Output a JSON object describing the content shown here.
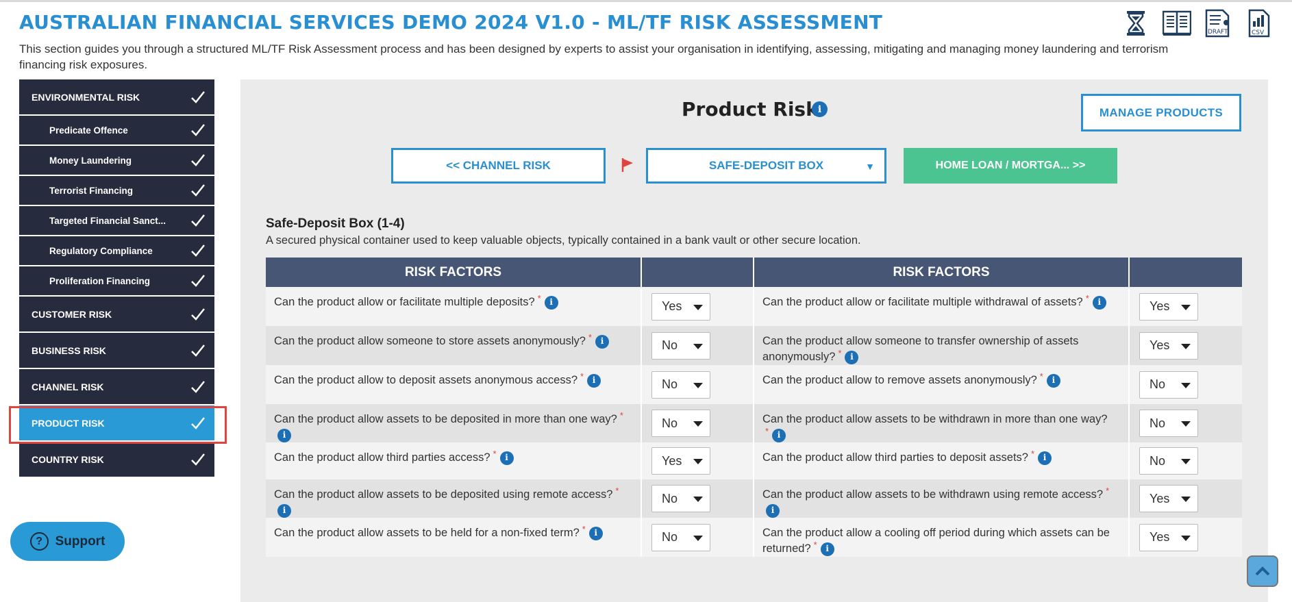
{
  "app": {
    "title": "AUSTRALIAN FINANCIAL SERVICES DEMO 2024 V1.0 - ML/TF RISK ASSESSMENT",
    "description": "This section guides you through a structured ML/TF Risk Assessment process and has been designed by experts to assist your organisation in identifying, assessing, mitigating and managing money laundering and terrorism financing risk exposures."
  },
  "top_icons": [
    "hourglass-icon",
    "book-icon",
    "draft-icon",
    "csv-icon"
  ],
  "top_icon_labels": {
    "draft": "DRAFT",
    "csv": "CSV"
  },
  "sidebar": {
    "items": [
      {
        "label": "ENVIRONMENTAL RISK",
        "type": "main",
        "completed": true
      },
      {
        "label": "Predicate Offence",
        "type": "sub",
        "completed": true
      },
      {
        "label": "Money Laundering",
        "type": "sub",
        "completed": true
      },
      {
        "label": "Terrorist Financing",
        "type": "sub",
        "completed": true
      },
      {
        "label": "Targeted Financial Sanct...",
        "type": "sub",
        "completed": true
      },
      {
        "label": "Regulatory Compliance",
        "type": "sub",
        "completed": true
      },
      {
        "label": "Proliferation Financing",
        "type": "sub",
        "completed": true
      },
      {
        "label": "CUSTOMER RISK",
        "type": "main",
        "completed": true
      },
      {
        "label": "BUSINESS RISK",
        "type": "main",
        "completed": true
      },
      {
        "label": "CHANNEL RISK",
        "type": "main",
        "completed": true
      },
      {
        "label": "PRODUCT RISK",
        "type": "main",
        "completed": true,
        "active": true
      },
      {
        "label": "COUNTRY RISK",
        "type": "main",
        "completed": true
      }
    ]
  },
  "support": {
    "label": "Support",
    "icon_glyph": "?"
  },
  "main": {
    "title": "Product Risk",
    "manage_products_label": "MANAGE PRODUCTS",
    "prev_label": "<< CHANNEL RISK",
    "current_product": "SAFE-DEPOSIT BOX",
    "next_label": "HOME LOAN / MORTGA... >>",
    "section_title": "Safe-Deposit Box (1-4)",
    "section_description": "A secured physical container used to keep valuable objects, typically contained in a bank vault or other secure location.",
    "table_headers": [
      "RISK FACTORS",
      "",
      "RISK FACTORS",
      ""
    ],
    "info_glyph": "i",
    "required_mark": "*",
    "rows": [
      {
        "left_q": "Can the product allow or facilitate multiple deposits?",
        "left_a": "Yes",
        "right_q": "Can the product allow or facilitate multiple withdrawal of assets?",
        "right_a": "Yes"
      },
      {
        "left_q": "Can the product allow someone to store assets anonymously?",
        "left_a": "No",
        "right_q": "Can the product allow someone to transfer ownership of assets anonymously?",
        "right_a": "Yes"
      },
      {
        "left_q": "Can the product allow to deposit assets anonymous access?",
        "left_a": "No",
        "right_q": "Can the product allow to remove assets anonymously?",
        "right_a": "No"
      },
      {
        "left_q": "Can the product allow assets to be deposited in more than one way?",
        "left_a": "No",
        "right_q": "Can the product allow assets to be withdrawn in more than one way?",
        "right_a": "No"
      },
      {
        "left_q": "Can the product allow third parties access?",
        "left_a": "Yes",
        "right_q": "Can the product allow third parties to deposit assets?",
        "right_a": "No"
      },
      {
        "left_q": "Can the product allow assets to be deposited using remote access?",
        "left_a": "No",
        "right_q": "Can the product allow assets to be withdrawn using remote access?",
        "right_a": "Yes"
      },
      {
        "left_q": "Can the product allow assets to be held for a non-fixed term?",
        "left_a": "No",
        "right_q": "Can the product allow a cooling off period during which assets can be returned?",
        "right_a": "Yes"
      }
    ]
  },
  "colors": {
    "brand_blue": "#2a8fd1",
    "sidebar_bg": "#262b3e",
    "sidebar_active": "#2a9ad6",
    "next_button": "#4cc491",
    "table_header": "#465674",
    "required": "#e0443f",
    "highlight_frame": "#e0443f"
  }
}
